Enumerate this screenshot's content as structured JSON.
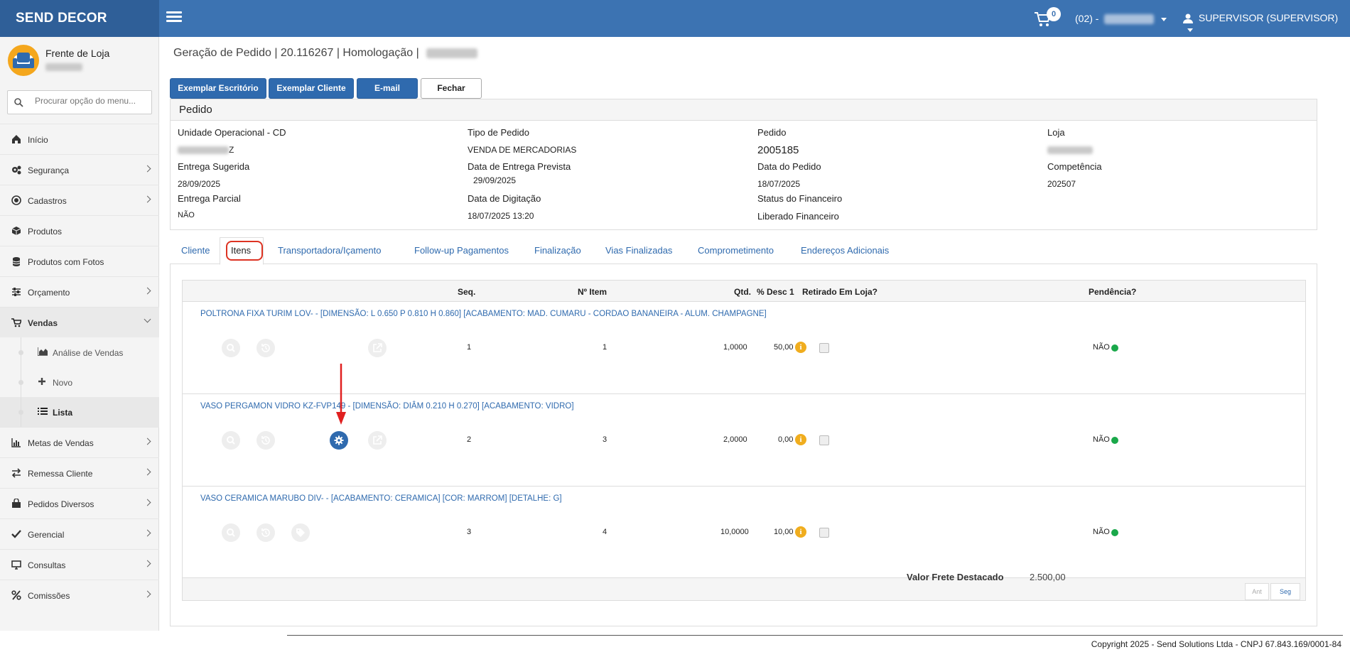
{
  "app": {
    "brand": "SEND DECOR",
    "cart_count": "0",
    "store_prefix": "(02) -",
    "user": "SUPERVISOR (SUPERVISOR)"
  },
  "sidebar": {
    "profile_name": "Frente de Loja",
    "search_placeholder": "Procurar opção do menu...",
    "items": [
      {
        "label": "Início",
        "icon": "home-icon"
      },
      {
        "label": "Segurança",
        "icon": "gears-icon"
      },
      {
        "label": "Cadastros",
        "icon": "target-icon"
      },
      {
        "label": "Produtos",
        "icon": "box-icon"
      },
      {
        "label": "Produtos com Fotos",
        "icon": "database-icon"
      },
      {
        "label": "Orçamento",
        "icon": "sliders-icon"
      },
      {
        "label": "Vendas",
        "icon": "cart-icon"
      },
      {
        "label": "Metas de Vendas",
        "icon": "bar-chart-icon"
      },
      {
        "label": "Remessa Cliente",
        "icon": "exchange-icon"
      },
      {
        "label": "Pedidos Diversos",
        "icon": "shopping-bag-icon"
      },
      {
        "label": "Gerencial",
        "icon": "check-icon"
      },
      {
        "label": "Consultas",
        "icon": "monitor-icon"
      },
      {
        "label": "Comissões",
        "icon": "percent-icon"
      }
    ],
    "vendas_sub": [
      {
        "label": "Análise de Vendas"
      },
      {
        "label": "Novo"
      },
      {
        "label": "Lista"
      }
    ]
  },
  "page": {
    "breadcrumb": "Geração de Pedido | 20.116267 | Homologação |",
    "buttons": {
      "exemplar_escritorio": "Exemplar Escritório",
      "exemplar_cliente": "Exemplar Cliente",
      "email": "E-mail",
      "fechar": "Fechar"
    },
    "panel_title": "Pedido",
    "fields": {
      "unidade_lbl": "Unidade Operacional - CD",
      "unidade_suffix": "Z",
      "tipo_lbl": "Tipo de Pedido",
      "tipo_val": "VENDA DE MERCADORIAS",
      "pedido_lbl": "Pedido",
      "pedido_val": "2005185",
      "loja_lbl": "Loja",
      "entrega_sug_lbl": "Entrega Sugerida",
      "entrega_sug_val": "28/09/2025",
      "entrega_prev_lbl": "Data de Entrega Prevista",
      "entrega_prev_val": "29/09/2025",
      "data_pedido_lbl": "Data do Pedido",
      "data_pedido_val": "18/07/2025",
      "competencia_lbl": "Competência",
      "competencia_val": "202507",
      "entrega_parcial_lbl": "Entrega Parcial",
      "entrega_parcial_val": "NÃO",
      "digitacao_lbl": "Data de Digitação",
      "digitacao_val": "18/07/2025 13:20",
      "status_fin_lbl": "Status do Financeiro",
      "status_fin_val": "Liberado Financeiro"
    },
    "tabs": [
      "Cliente",
      "Itens",
      "Transportadora/Içamento",
      "Follow-up Pagamentos",
      "Finalização",
      "Vias Finalizadas",
      "Comprometimento",
      "Endereços Adicionais"
    ],
    "grid_headers": {
      "seq": "Seq.",
      "item": "Nº Item",
      "qtd": "Qtd.",
      "desc": "% Desc 1",
      "retirado": "Retirado Em Loja?",
      "pendencia": "Pendência?"
    },
    "rows": [
      {
        "desc": "POLTRONA FIXA TURIM LOV- - [DIMENSÃO: L 0.650 P 0.810 H 0.860] [ACABAMENTO: MAD. CUMARU - CORDAO BANANEIRA - ALUM. CHAMPAGNE]",
        "seq": "1",
        "item": "1",
        "qtd": "1,0000",
        "desc1": "50,00",
        "pend": "NÃO"
      },
      {
        "desc": "VASO PERGAMON VIDRO KZ-FVP149 - [DIMENSÃO: DIÂM 0.210 H 0.270] [ACABAMENTO: VIDRO]",
        "seq": "2",
        "item": "3",
        "qtd": "2,0000",
        "desc1": "0,00",
        "pend": "NÃO"
      },
      {
        "desc": "VASO CERAMICA MARUBO DIV- - [ACABAMENTO: CERAMICA] [COR: MARROM] [DETALHE: G]",
        "seq": "3",
        "item": "4",
        "qtd": "10,0000",
        "desc1": "10,00",
        "pend": "NÃO"
      }
    ],
    "pager": {
      "prev": "Ant",
      "next": "Seg"
    },
    "frete_label": "Valor Frete Destacado",
    "frete_value": "2.500,00",
    "info_glyph": "i"
  },
  "footer": "Copyright 2025 - Send Solutions Ltda - CNPJ 67.843.169/0001-84"
}
